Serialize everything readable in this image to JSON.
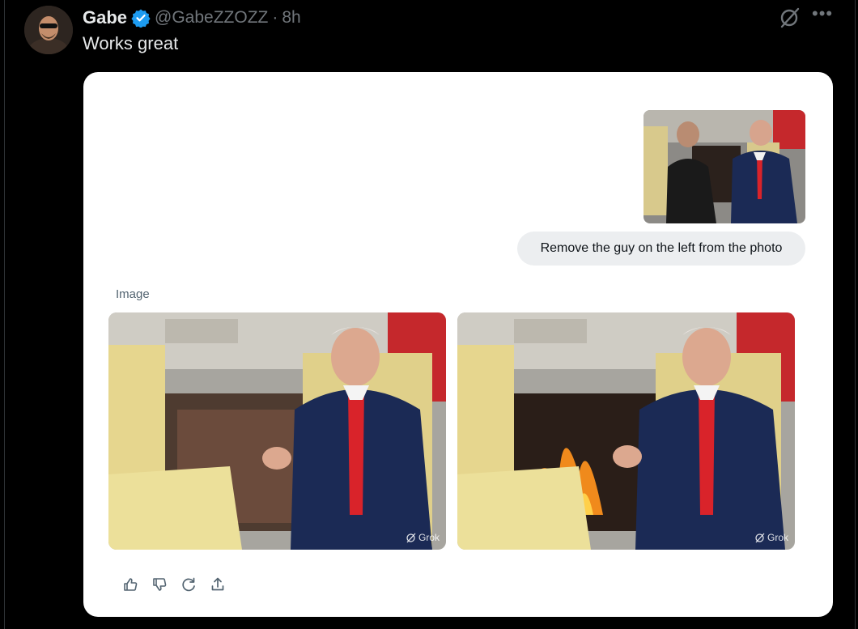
{
  "tweet": {
    "display_name": "Gabe",
    "handle": "@GabeZZOZZ",
    "separator": "·",
    "time": "8h",
    "text": "Works great",
    "verified_icon": "verified-badge-icon",
    "header_icons": [
      "grok-icon",
      "more-icon"
    ],
    "more_glyph": "•••"
  },
  "card": {
    "prompt": "Remove the guy on the left from the photo",
    "image_label": "Image",
    "watermark": "Grok",
    "actions": [
      "thumbs-up-icon",
      "thumbs-down-icon",
      "regenerate-icon",
      "share-icon"
    ]
  },
  "colors": {
    "background": "#000000",
    "text_primary": "#e7e9ea",
    "text_secondary": "#71767b",
    "verified_blue": "#1d9bf0",
    "card_background": "#ffffff",
    "bubble_background": "#eceef0"
  }
}
